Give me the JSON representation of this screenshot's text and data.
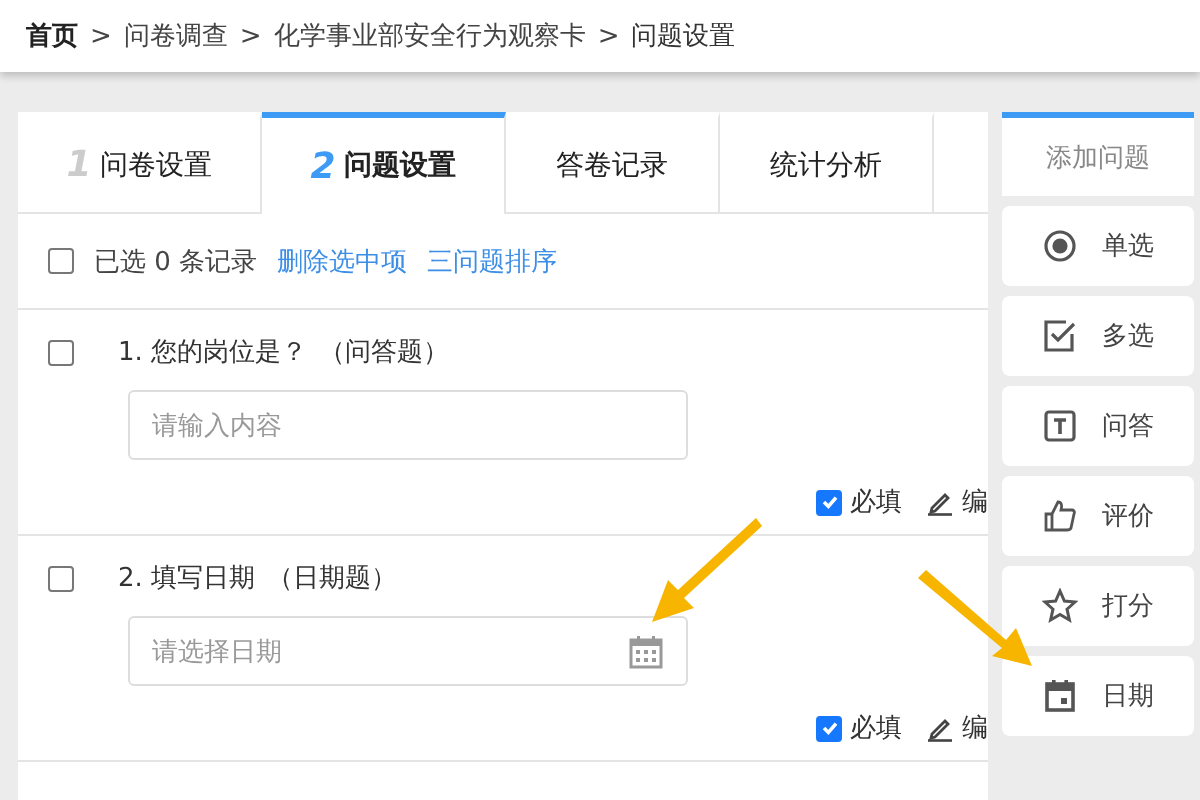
{
  "breadcrumb": [
    {
      "label": "首页",
      "current": false
    },
    {
      "label": "问卷调查",
      "current": false
    },
    {
      "label": "化学事业部安全行为观察卡",
      "current": false
    },
    {
      "label": "问题设置",
      "current": true
    }
  ],
  "breadcrumb_separator": ">",
  "tabs": [
    {
      "number": "1",
      "label": "问卷设置",
      "selected": false
    },
    {
      "number": "2",
      "label": "问题设置",
      "selected": true
    },
    {
      "label": "答卷记录",
      "selected": false
    },
    {
      "label": "统计分析",
      "selected": false
    }
  ],
  "toolbar": {
    "select_all": {
      "checked": false
    },
    "summary": "已选 0 条记录",
    "actions": [
      "删除选中项",
      "三问题排序"
    ]
  },
  "questions": [
    {
      "kind": "text",
      "checked": false,
      "title": "1. 您的岗位是？",
      "type": "（问答题）",
      "placeholder": "请输入内容",
      "required": {
        "label": "必填",
        "checked": true
      },
      "edit": "编"
    },
    {
      "kind": "date",
      "checked": false,
      "title": "2. 填写日期",
      "type": "（日期题）",
      "placeholder": "请选择日期",
      "required": {
        "label": "必填",
        "checked": true
      },
      "edit": "编"
    }
  ],
  "add_panel": {
    "title": "添加问题",
    "items": [
      {
        "kind": "radio",
        "label": "单选"
      },
      {
        "kind": "checkbox",
        "label": "多选"
      },
      {
        "kind": "text",
        "label": "问答"
      },
      {
        "kind": "like",
        "label": "评价"
      },
      {
        "kind": "star",
        "label": "打分"
      },
      {
        "kind": "date",
        "label": "日期"
      }
    ]
  }
}
